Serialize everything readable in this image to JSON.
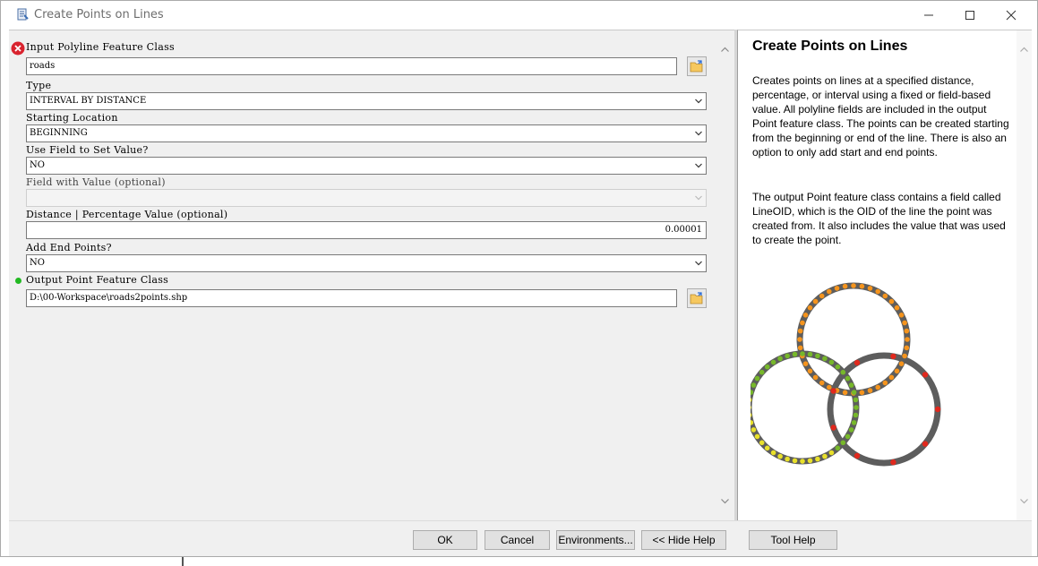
{
  "window": {
    "title": "Create Points on Lines"
  },
  "params": {
    "input_label": "Input Polyline Feature Class",
    "input_value": "roads",
    "type_label": "Type",
    "type_value": "INTERVAL BY DISTANCE",
    "start_label": "Starting Location",
    "start_value": "BEGINNING",
    "usefield_label": "Use Field to Set Value?",
    "usefield_value": "NO",
    "fieldval_label": "Field with Value (optional)",
    "fieldval_value": "",
    "distance_label": "Distance | Percentage Value (optional)",
    "distance_value": "0.00001",
    "endpoints_label": "Add End Points?",
    "endpoints_value": "NO",
    "output_label": "Output Point Feature Class",
    "output_value": "D:\\00-Workspace\\roads2points.shp"
  },
  "help": {
    "title": "Create Points on Lines",
    "para1": "Creates points on lines at a specified distance, percentage, or interval using a fixed or field-based value. All polyline fields are included in the output Point feature class. The points can be created starting from the beginning or end of the line. There is also an option to only add start and end points.",
    "para2": "The output Point feature class contains a field called LineOID, which is the OID of the line the point was created from. It also includes the value that was used to create the point."
  },
  "buttons": {
    "ok": "OK",
    "cancel": "Cancel",
    "environments": "Environments...",
    "hide_help": "<< Hide Help",
    "tool_help": "Tool Help"
  },
  "icons": {
    "error": "error-icon",
    "valid": "valid-dot-icon",
    "browse": "folder-browse-icon",
    "dropdown": "chevron-down-icon",
    "app": "toolbox-script-icon"
  },
  "colors": {
    "error_red": "#d9232e",
    "valid_green": "#22b922",
    "ring_gray": "#5d5d5d",
    "point_orange": "#f5941d",
    "point_green": "#77b82a",
    "point_yellow": "#e8e02b",
    "point_red": "#e0281d"
  }
}
